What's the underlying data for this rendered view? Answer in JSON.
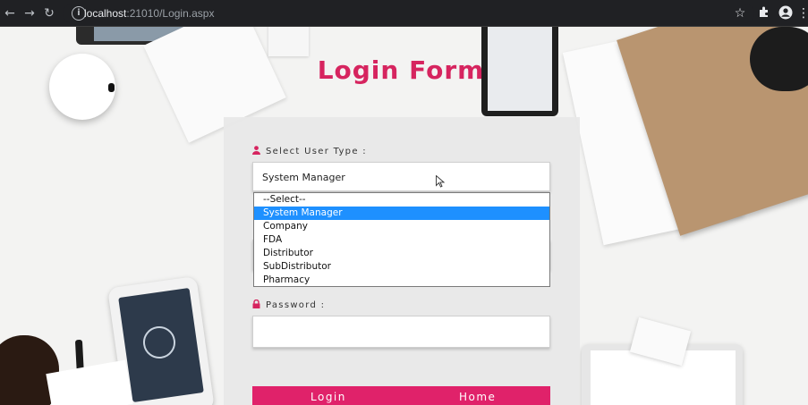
{
  "browser": {
    "url_host": "localhost",
    "url_rest": ":21010/Login.aspx",
    "icons": [
      "back-arrow-icon",
      "forward-arrow-icon",
      "reload-icon",
      "info-icon",
      "star-icon",
      "extension-icon",
      "profile-icon",
      "menu-icon"
    ]
  },
  "form": {
    "title": "Login Form",
    "user_type_label": "Select User Type :",
    "selected_value": "System Manager",
    "options": [
      "--Select--",
      "System Manager",
      "Company",
      "FDA",
      "Distributor",
      "SubDistributor",
      "Pharmacy"
    ],
    "highlighted_index": 1,
    "password_label": "Password :",
    "login_button": "Login",
    "home_button": "Home"
  },
  "colors": {
    "accent": "#d6245f",
    "button": "#e0226a",
    "selection": "#1e90ff"
  }
}
